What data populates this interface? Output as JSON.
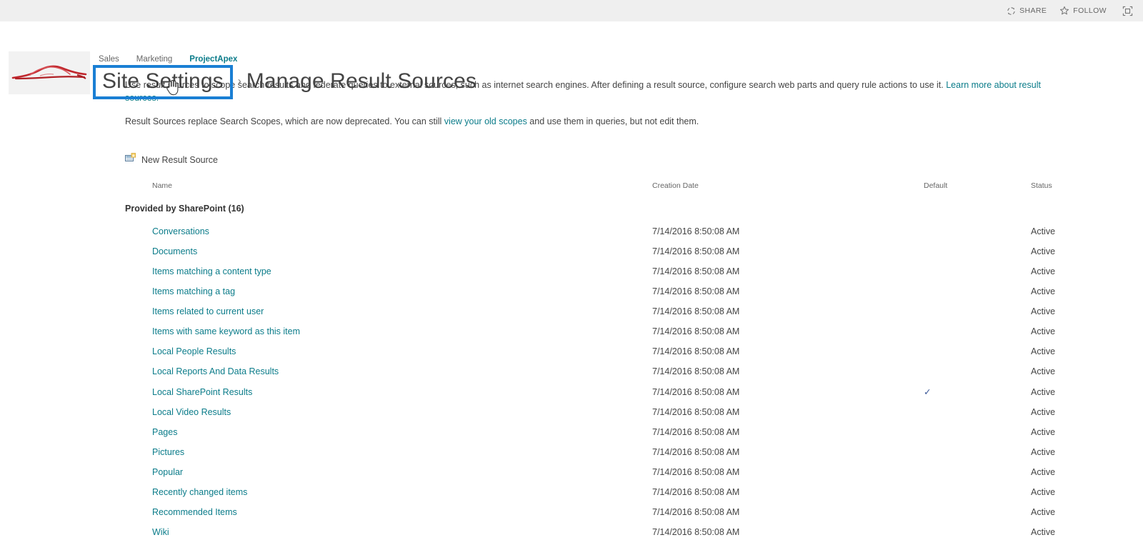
{
  "suite_bar": {
    "share_label": "SHARE",
    "follow_label": "FOLLOW",
    "share_icon": "share-circular-arrows-icon",
    "follow_icon": "star-icon",
    "focus_icon": "focus-on-content-icon"
  },
  "header": {
    "logo_alt": "car-silhouette-logo",
    "nav": [
      {
        "label": "Sales",
        "current": false
      },
      {
        "label": "Marketing",
        "current": false
      },
      {
        "label": "ProjectApex",
        "current": true
      }
    ],
    "breadcrumb_parent": "Site Settings",
    "breadcrumb_separator": "›",
    "page_title": "Manage Result Sources",
    "highlight_color": "#1a7fd4"
  },
  "intro": {
    "paragraph1_part1": "Use result sources to scope search results and federate queries to external sources, such as internet search engines. After defining a result source, configure search web parts and query rule actions to use it. ",
    "paragraph1_link": "Learn more about result sources.",
    "paragraph2_part1": "Result Sources replace Search Scopes, which are now deprecated. You can still ",
    "paragraph2_link": "view your old scopes",
    "paragraph2_part2": " and use them in queries, but not edit them."
  },
  "toolbar": {
    "new_result_source_label": "New Result Source",
    "new_result_source_icon": "new-document-icon"
  },
  "table": {
    "columns": [
      "Name",
      "Creation Date",
      "Default",
      "Status"
    ],
    "group_header": "Provided by SharePoint (16)",
    "default_check_glyph": "✓",
    "rows": [
      {
        "name": "Conversations",
        "date": "7/14/2016 8:50:08 AM",
        "default": "",
        "status": "Active"
      },
      {
        "name": "Documents",
        "date": "7/14/2016 8:50:08 AM",
        "default": "",
        "status": "Active"
      },
      {
        "name": "Items matching a content type",
        "date": "7/14/2016 8:50:08 AM",
        "default": "",
        "status": "Active"
      },
      {
        "name": "Items matching a tag",
        "date": "7/14/2016 8:50:08 AM",
        "default": "",
        "status": "Active"
      },
      {
        "name": "Items related to current user",
        "date": "7/14/2016 8:50:08 AM",
        "default": "",
        "status": "Active"
      },
      {
        "name": "Items with same keyword as this item",
        "date": "7/14/2016 8:50:08 AM",
        "default": "",
        "status": "Active"
      },
      {
        "name": "Local People Results",
        "date": "7/14/2016 8:50:08 AM",
        "default": "",
        "status": "Active"
      },
      {
        "name": "Local Reports And Data Results",
        "date": "7/14/2016 8:50:08 AM",
        "default": "",
        "status": "Active"
      },
      {
        "name": "Local SharePoint Results",
        "date": "7/14/2016 8:50:08 AM",
        "default": "✓",
        "status": "Active"
      },
      {
        "name": "Local Video Results",
        "date": "7/14/2016 8:50:08 AM",
        "default": "",
        "status": "Active"
      },
      {
        "name": "Pages",
        "date": "7/14/2016 8:50:08 AM",
        "default": "",
        "status": "Active"
      },
      {
        "name": "Pictures",
        "date": "7/14/2016 8:50:08 AM",
        "default": "",
        "status": "Active"
      },
      {
        "name": "Popular",
        "date": "7/14/2016 8:50:08 AM",
        "default": "",
        "status": "Active"
      },
      {
        "name": "Recently changed items",
        "date": "7/14/2016 8:50:08 AM",
        "default": "",
        "status": "Active"
      },
      {
        "name": "Recommended Items",
        "date": "7/14/2016 8:50:08 AM",
        "default": "",
        "status": "Active"
      },
      {
        "name": "Wiki",
        "date": "7/14/2016 8:50:08 AM",
        "default": "",
        "status": "Active"
      }
    ]
  }
}
